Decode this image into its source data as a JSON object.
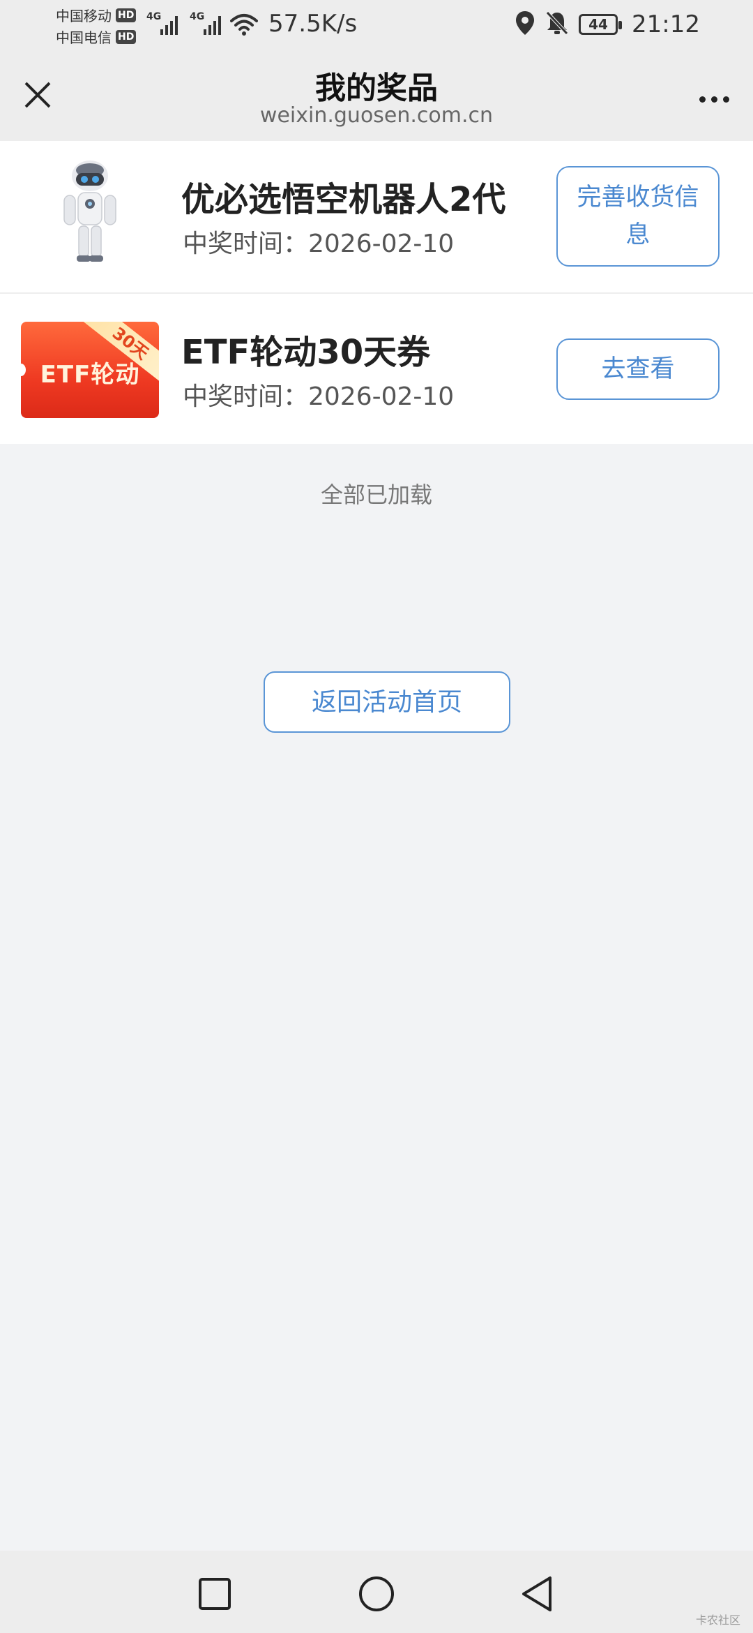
{
  "status_bar": {
    "carrier1": "中国移动",
    "carrier2": "中国电信",
    "hd_badge": "HD",
    "network_gen": "4G",
    "net_speed": "57.5K/s",
    "battery_level": "44",
    "time": "21:12",
    "icons": [
      "signal-icon",
      "wifi-icon",
      "location-icon",
      "bell-off-icon",
      "battery-icon"
    ]
  },
  "header": {
    "title": "我的奖品",
    "domain": "weixin.guosen.com.cn",
    "icons": [
      "close-icon",
      "more-icon"
    ]
  },
  "prizes": [
    {
      "name": "优必选悟空机器人2代",
      "date": "中奖时间：2026-02-10",
      "action_label": "完善收货信息",
      "image": "robot"
    },
    {
      "name": "ETF轮动30天券",
      "date": "中奖时间：2026-02-10",
      "action_label": "去查看",
      "image": "coupon",
      "coupon_text": "ETF轮动",
      "coupon_ribbon": "30天"
    }
  ],
  "list_footer": "全部已加载",
  "back_button": "返回活动首页",
  "nav_bar": {
    "icons": [
      "recent-apps-icon",
      "home-icon",
      "back-icon"
    ]
  },
  "watermark": "卡农社区",
  "colors": {
    "accent": "#4a88d0",
    "page_bg": "#f2f3f5",
    "coupon_red": "#ef3a22"
  }
}
